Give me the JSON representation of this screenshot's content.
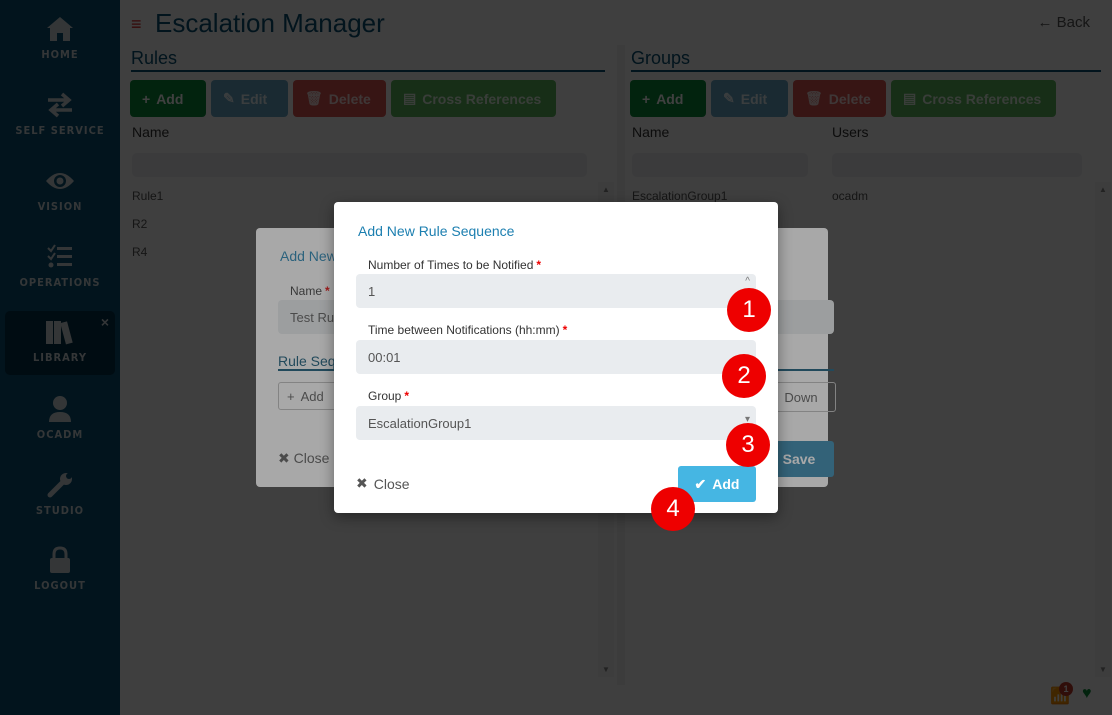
{
  "sidebar": {
    "items": [
      {
        "label": "HOME",
        "icon": "home-icon"
      },
      {
        "label": "SELF SERVICE",
        "icon": "swap-arrows-icon"
      },
      {
        "label": "VISION",
        "icon": "eye-icon"
      },
      {
        "label": "OPERATIONS",
        "icon": "checklist-icon"
      },
      {
        "label": "LIBRARY",
        "icon": "books-icon",
        "active": true,
        "close": "×"
      },
      {
        "label": "OCADM",
        "icon": "user-icon"
      },
      {
        "label": "STUDIO",
        "icon": "wrench-icon"
      },
      {
        "label": "LOGOUT",
        "icon": "lock-icon"
      }
    ]
  },
  "header": {
    "menu_icon": "≡",
    "title": "Escalation Manager",
    "back_label": "Back",
    "back_icon": "←"
  },
  "rules": {
    "title": "Rules",
    "buttons": {
      "add": "Add",
      "edit": "Edit",
      "delete": "Delete",
      "xref": "Cross References"
    },
    "columns": [
      "Name"
    ],
    "rows": [
      "Rule1",
      "R2",
      "R4"
    ]
  },
  "groups": {
    "title": "Groups",
    "buttons": {
      "add": "Add",
      "edit": "Edit",
      "delete": "Delete",
      "xref": "Cross References"
    },
    "columns": [
      "Name",
      "Users"
    ],
    "rows": [
      {
        "name": "EscalationGroup1",
        "users": "ocadm"
      }
    ]
  },
  "background_dialog": {
    "title": "Add New",
    "name_label": "Name",
    "name_value": "Test Ru",
    "section": "Rule Seq",
    "add_label": "Add",
    "down_label": "Down",
    "close_label": "Close",
    "save_label": "Save"
  },
  "dialog": {
    "title": "Add New Rule Sequence",
    "fields": [
      {
        "label": "Number of Times to be Notified",
        "value": "1",
        "required": "*",
        "arrow": "^"
      },
      {
        "label": "Time between Notifications (hh:mm)",
        "value": "00:01",
        "required": "*"
      },
      {
        "label": "Group",
        "value": "EscalationGroup1",
        "required": "*",
        "arrow": "▾"
      }
    ],
    "close_label": "Close",
    "add_label": "Add"
  },
  "markers": [
    "1",
    "2",
    "3",
    "4"
  ],
  "status": {
    "rss_badge": "1"
  },
  "colors": {
    "sidebar": "#0a5273",
    "accent": "#1c7fb0",
    "add": "#0a8a3a",
    "marker": "#ee0000",
    "primary_button": "#45b6e3"
  }
}
